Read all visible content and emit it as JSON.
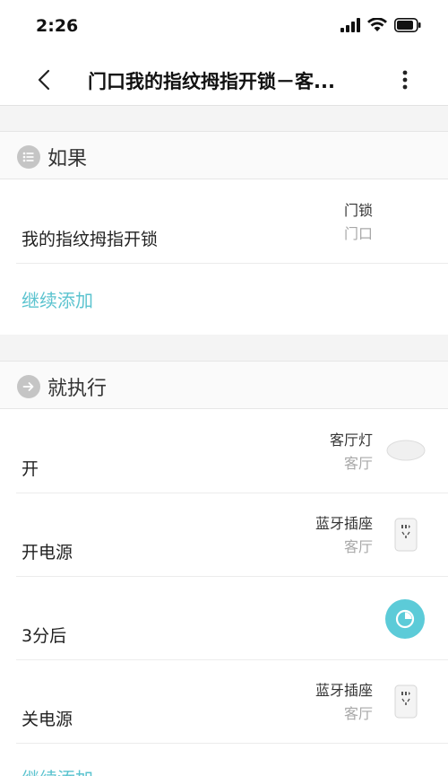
{
  "status_bar": {
    "time": "2:26"
  },
  "nav": {
    "title": "门口我的指纹拇指开锁－客..."
  },
  "if_section": {
    "header": "如果",
    "conditions": [
      {
        "label": "我的指纹拇指开锁",
        "device": "门锁",
        "room": "门口"
      }
    ],
    "add_label": "继续添加"
  },
  "then_section": {
    "header": "就执行",
    "actions": [
      {
        "label": "开",
        "device": "客厅灯",
        "room": "客厅",
        "icon": "ceiling-light-icon"
      },
      {
        "label": "开电源",
        "device": "蓝牙插座",
        "room": "客厅",
        "icon": "power-socket-icon"
      },
      {
        "label": "3分后",
        "icon": "timer-icon"
      },
      {
        "label": "关电源",
        "device": "蓝牙插座",
        "room": "客厅",
        "icon": "power-socket-icon"
      }
    ],
    "add_label": "继续添加"
  },
  "colors": {
    "accent": "#5bc3cf",
    "timer_bg": "#5ccbd8",
    "header_icon": "#c5c5c5"
  }
}
